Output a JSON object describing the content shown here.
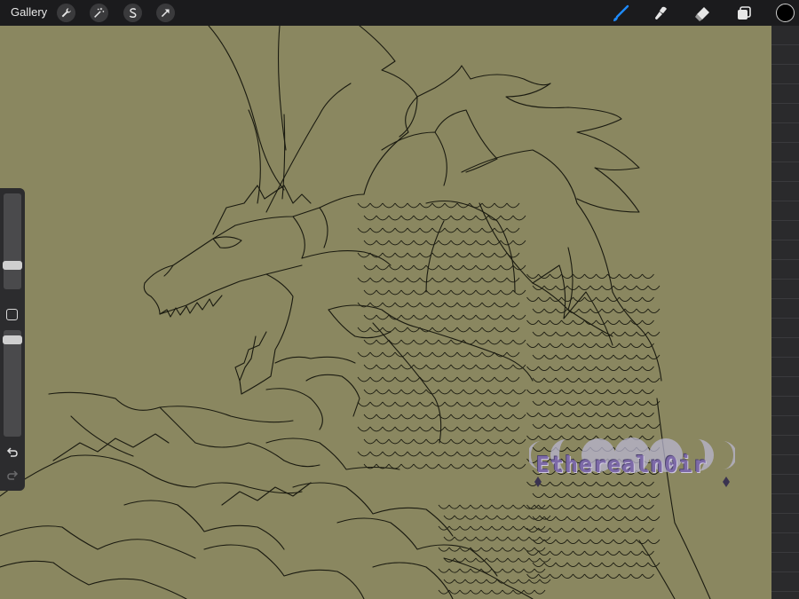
{
  "topbar": {
    "gallery_label": "Gallery",
    "left_tools": [
      {
        "name": "actions",
        "icon": "wrench-icon"
      },
      {
        "name": "adjustments",
        "icon": "magic-wand-icon"
      },
      {
        "name": "selection",
        "icon": "selection-s-icon"
      },
      {
        "name": "transform",
        "icon": "transform-arrow-icon"
      }
    ],
    "right_tools": [
      {
        "name": "brush",
        "icon": "brush-icon",
        "active": true
      },
      {
        "name": "smudge",
        "icon": "smudge-icon",
        "active": false
      },
      {
        "name": "eraser",
        "icon": "eraser-icon",
        "active": false
      },
      {
        "name": "layers",
        "icon": "layers-icon",
        "active": false
      }
    ],
    "current_color": "#000000",
    "active_color": "#1e8bff"
  },
  "sidebar": {
    "brush_size": 0.22,
    "opacity": 0.95,
    "modify_icon": "square-icon",
    "undo_icon": "undo-icon",
    "redo_icon": "redo-icon"
  },
  "canvas": {
    "background_color": "#8a8760",
    "line_color": "#1a1a10"
  },
  "watermark": {
    "text": "Etherealn0ir",
    "icon": "moon-phases-icon"
  }
}
